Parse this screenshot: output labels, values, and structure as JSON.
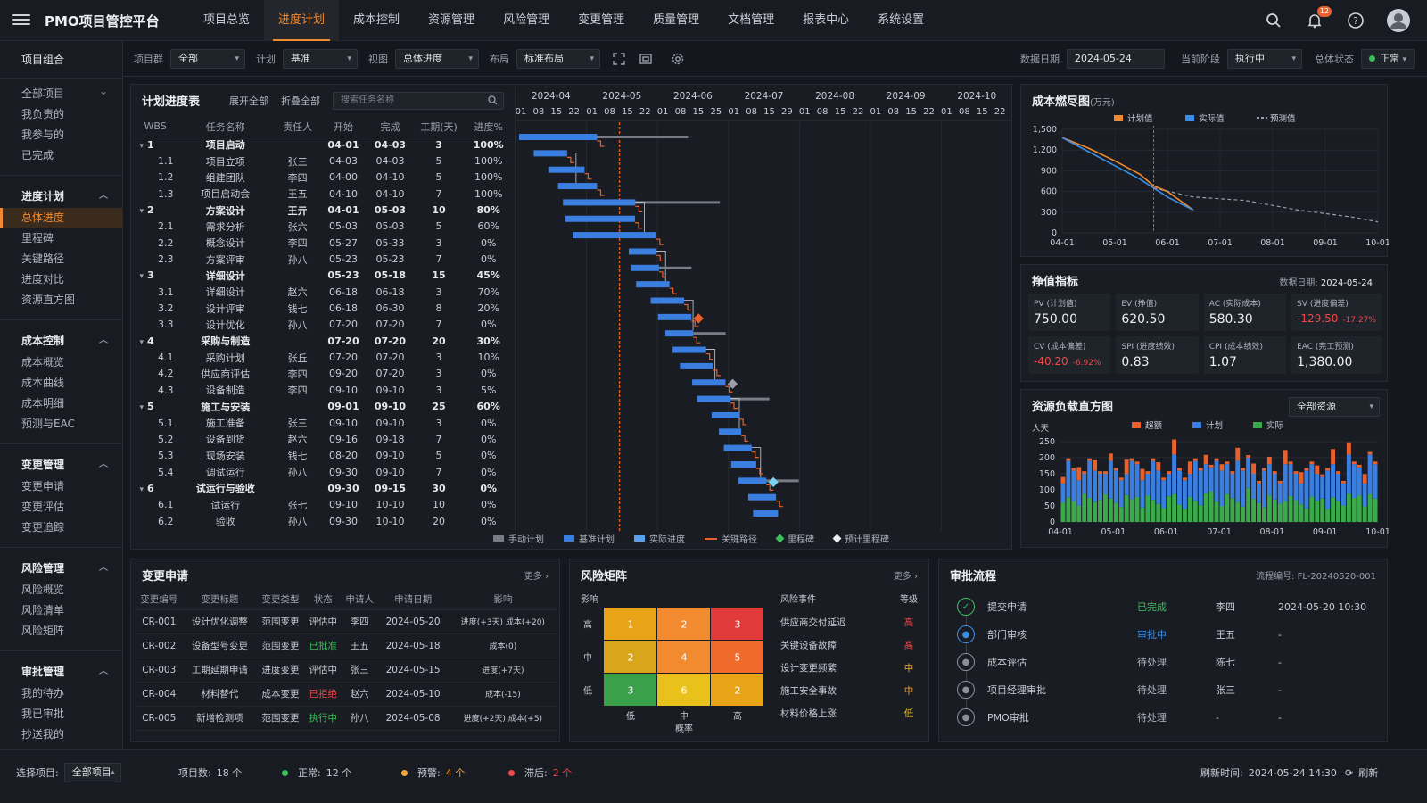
{
  "app": {
    "title": "PMO项目管控平台",
    "notif_count": "12"
  },
  "nav": [
    "项目总览",
    "进度计划",
    "成本控制",
    "资源管理",
    "风险管理",
    "变更管理",
    "质量管理",
    "文档管理",
    "报表中心",
    "系统设置"
  ],
  "sidebar": {
    "head": "项目组合",
    "all": [
      "全部项目",
      "我负责的",
      "我参与的",
      "已完成"
    ],
    "groups": [
      {
        "title": "进度计划",
        "items": [
          "总体进度",
          "里程碑",
          "关键路径",
          "进度对比",
          "资源直方图"
        ]
      },
      {
        "title": "成本控制",
        "items": [
          "成本概览",
          "成本曲线",
          "成本明细",
          "预测与EAC"
        ]
      },
      {
        "title": "变更管理",
        "items": [
          "变更申请",
          "变更评估",
          "变更追踪"
        ]
      },
      {
        "title": "风险管理",
        "items": [
          "风险概览",
          "风险清单",
          "风险矩阵"
        ]
      },
      {
        "title": "审批管理",
        "items": [
          "我的待办",
          "我已审批",
          "抄送我的"
        ]
      }
    ]
  },
  "filters": {
    "group_label": "项目群",
    "group": "全部",
    "plan_label": "计划",
    "plan": "基准",
    "view_label": "视图",
    "view": "总体进度",
    "layout_label": "布局",
    "layout": "标准布局",
    "date_label": "数据日期",
    "date": "2024-05-24",
    "phase_label": "当前阶段",
    "phase": "执行中",
    "status_label": "总体状态",
    "status": "正常"
  },
  "plan": {
    "title": "计划进度表",
    "expand": "展开全部",
    "collapse": "折叠全部",
    "search_placeholder": "搜索任务名称",
    "cols": [
      "WBS",
      "任务名称",
      "责任人",
      "开始",
      "完成",
      "工期(天)",
      "进度%"
    ],
    "rows": [
      {
        "wbs": "1",
        "name": "项目启动",
        "owner": "",
        "start": "04-01",
        "end": "04-03",
        "dur": "3",
        "pct": "100%",
        "grp": true
      },
      {
        "wbs": "1.1",
        "name": "项目立项",
        "owner": "张三",
        "start": "04-03",
        "end": "04-03",
        "dur": "5",
        "pct": "100%"
      },
      {
        "wbs": "1.2",
        "name": "组建团队",
        "owner": "李四",
        "start": "04-00",
        "end": "04-10",
        "dur": "5",
        "pct": "100%"
      },
      {
        "wbs": "1.3",
        "name": "项目启动会",
        "owner": "王五",
        "start": "04-10",
        "end": "04-10",
        "dur": "7",
        "pct": "100%"
      },
      {
        "wbs": "2",
        "name": "方案设计",
        "owner": "王亓",
        "start": "04-01",
        "end": "05-03",
        "dur": "10",
        "pct": "80%",
        "grp": true
      },
      {
        "wbs": "2.1",
        "name": "需求分析",
        "owner": "张六",
        "start": "05-03",
        "end": "05-03",
        "dur": "5",
        "pct": "60%"
      },
      {
        "wbs": "2.2",
        "name": "概念设计",
        "owner": "李四",
        "start": "05-27",
        "end": "05-33",
        "dur": "3",
        "pct": "0%"
      },
      {
        "wbs": "2.3",
        "name": "方案评审",
        "owner": "孙八",
        "start": "05-23",
        "end": "05-23",
        "dur": "7",
        "pct": "0%"
      },
      {
        "wbs": "3",
        "name": "详细设计",
        "owner": "",
        "start": "05-23",
        "end": "05-18",
        "dur": "15",
        "pct": "45%",
        "grp": true
      },
      {
        "wbs": "3.1",
        "name": "详细设计",
        "owner": "赵六",
        "start": "06-18",
        "end": "06-18",
        "dur": "3",
        "pct": "70%"
      },
      {
        "wbs": "3.2",
        "name": "设计评审",
        "owner": "钱七",
        "start": "06-18",
        "end": "06-30",
        "dur": "8",
        "pct": "20%"
      },
      {
        "wbs": "3.3",
        "name": "设计优化",
        "owner": "孙八",
        "start": "07-20",
        "end": "07-20",
        "dur": "7",
        "pct": "0%"
      },
      {
        "wbs": "4",
        "name": "采购与制造",
        "owner": "",
        "start": "07-20",
        "end": "07-20",
        "dur": "20",
        "pct": "30%",
        "grp": true
      },
      {
        "wbs": "4.1",
        "name": "采购计划",
        "owner": "张丘",
        "start": "07-20",
        "end": "07-20",
        "dur": "3",
        "pct": "10%"
      },
      {
        "wbs": "4.2",
        "name": "供应商评估",
        "owner": "李四",
        "start": "09-20",
        "end": "07-20",
        "dur": "3",
        "pct": "0%"
      },
      {
        "wbs": "4.3",
        "name": "设备制造",
        "owner": "李四",
        "start": "09-10",
        "end": "09-10",
        "dur": "3",
        "pct": "5%"
      },
      {
        "wbs": "5",
        "name": "施工与安装",
        "owner": "",
        "start": "09-01",
        "end": "09-10",
        "dur": "25",
        "pct": "60%",
        "grp": true
      },
      {
        "wbs": "5.1",
        "name": "施工准备",
        "owner": "张三",
        "start": "09-10",
        "end": "09-10",
        "dur": "3",
        "pct": "0%"
      },
      {
        "wbs": "5.2",
        "name": "设备到货",
        "owner": "赵六",
        "start": "09-16",
        "end": "09-18",
        "dur": "7",
        "pct": "0%"
      },
      {
        "wbs": "5.3",
        "name": "现场安装",
        "owner": "钱七",
        "start": "08-20",
        "end": "09-10",
        "dur": "5",
        "pct": "0%"
      },
      {
        "wbs": "5.4",
        "name": "调试运行",
        "owner": "孙八",
        "start": "09-30",
        "end": "09-10",
        "dur": "7",
        "pct": "0%"
      },
      {
        "wbs": "6",
        "name": "试运行与验收",
        "owner": "",
        "start": "09-30",
        "end": "09-15",
        "dur": "30",
        "pct": "0%",
        "grp": true
      },
      {
        "wbs": "6.1",
        "name": "试运行",
        "owner": "张七",
        "start": "09-10",
        "end": "10-10",
        "dur": "10",
        "pct": "0%"
      },
      {
        "wbs": "6.2",
        "name": "验收",
        "owner": "孙八",
        "start": "09-30",
        "end": "10-10",
        "dur": "20",
        "pct": "0%"
      }
    ],
    "months": [
      "2024-04",
      "2024-05",
      "2024-06",
      "2024-07",
      "2024-08",
      "2024-09",
      "2024-10"
    ],
    "days": [
      [
        "01",
        "08",
        "15",
        "22"
      ],
      [
        "01",
        "08",
        "15",
        "22"
      ],
      [
        "01",
        "08",
        "15",
        "25"
      ],
      [
        "01",
        "08",
        "15",
        "29"
      ],
      [
        "01",
        "08",
        "15",
        "22"
      ],
      [
        "01",
        "08",
        "15",
        "22"
      ],
      [
        "01",
        "08",
        "15",
        "22"
      ]
    ],
    "legend": [
      "手动计划",
      "基准计划",
      "实际进度",
      "关键路径",
      "里程碑",
      "预计里程碑"
    ]
  },
  "burn": {
    "title": "成本燃尽图",
    "unit": "(万元)",
    "legend": [
      "计划值",
      "实际值",
      "预测值"
    ],
    "yticks": [
      "1,500",
      "1,200",
      "900",
      "600",
      "300",
      "0"
    ],
    "xticks": [
      "04-01",
      "05-01",
      "06-01",
      "07-01",
      "08-01",
      "09-01",
      "10-01"
    ]
  },
  "ev": {
    "title": "挣值指标",
    "date_label": "数据日期:",
    "date": "2024-05-24",
    "cells": [
      {
        "label": "PV (计划值)",
        "value": "750.00"
      },
      {
        "label": "EV (挣值)",
        "value": "620.50"
      },
      {
        "label": "AC (实际成本)",
        "value": "580.30"
      },
      {
        "label": "SV (进度偏差)",
        "value": "-129.50",
        "pct": "-17.27%",
        "neg": true
      },
      {
        "label": "CV (成本偏差)",
        "value": "-40.20",
        "pct": "-6.92%",
        "neg": true
      },
      {
        "label": "SPI (进度绩效)",
        "value": "0.83"
      },
      {
        "label": "CPI (成本绩效)",
        "value": "1.07"
      },
      {
        "label": "EAC (完工预测)",
        "value": "1,380.00"
      }
    ]
  },
  "res": {
    "title": "资源负载直方图",
    "select": "全部资源",
    "unit": "人天",
    "legend": [
      "超额",
      "计划",
      "实际"
    ],
    "yticks": [
      "250",
      "200",
      "150",
      "100",
      "50",
      "0"
    ],
    "xticks": [
      "04-01",
      "05-01",
      "06-01",
      "07-01",
      "08-01",
      "09-01",
      "10-01"
    ]
  },
  "chg": {
    "title": "变更申请",
    "more": "更多 ›",
    "cols": [
      "变更编号",
      "变更标题",
      "变更类型",
      "状态",
      "申请人",
      "申请日期",
      "影响"
    ],
    "rows": [
      {
        "id": "CR-001",
        "title": "设计优化调整",
        "type": "范围变更",
        "status": "评估中",
        "sc": "#c8ccd4",
        "who": "李四",
        "date": "2024-05-20",
        "impact": "进度(+3天) 成本(+20)"
      },
      {
        "id": "CR-002",
        "title": "设备型号变更",
        "type": "范围变更",
        "status": "已批准",
        "sc": "#3bbf5a",
        "who": "王五",
        "date": "2024-05-18",
        "impact": "成本(0)"
      },
      {
        "id": "CR-003",
        "title": "工期延期申请",
        "type": "进度变更",
        "status": "评估中",
        "sc": "#c8ccd4",
        "who": "张三",
        "date": "2024-05-15",
        "impact": "进度(+7天)"
      },
      {
        "id": "CR-004",
        "title": "材料替代",
        "type": "成本变更",
        "status": "已拒绝",
        "sc": "#f04848",
        "who": "赵六",
        "date": "2024-05-10",
        "impact": "成本(-15)"
      },
      {
        "id": "CR-005",
        "title": "新增检测项",
        "type": "范围变更",
        "status": "执行中",
        "sc": "#3bbf5a",
        "who": "孙八",
        "date": "2024-05-08",
        "impact": "进度(+2天) 成本(+5)"
      }
    ]
  },
  "risk": {
    "title": "风险矩阵",
    "more": "更多 ›",
    "ylabel": "影响",
    "xlabel": "概率",
    "rows": [
      "高",
      "中",
      "低"
    ],
    "cols": [
      "低",
      "中",
      "高"
    ],
    "cells": [
      [
        "1",
        "2",
        "3"
      ],
      [
        "2",
        "4",
        "5"
      ],
      [
        "3",
        "6",
        "2"
      ]
    ],
    "colors": [
      [
        "#e8a317",
        "#f28b30",
        "#e03a3a"
      ],
      [
        "#d9a51a",
        "#f28b30",
        "#f06a2c"
      ],
      [
        "#3aa04a",
        "#e8c21a",
        "#e8a317"
      ]
    ],
    "ev_label": "风险事件",
    "lvl_label": "等级",
    "events": [
      {
        "name": "供应商交付延迟",
        "lvl": "高",
        "c": "#f04848"
      },
      {
        "name": "关键设备故障",
        "lvl": "高",
        "c": "#f04848"
      },
      {
        "name": "设计变更频繁",
        "lvl": "中",
        "c": "#f2a23a"
      },
      {
        "name": "施工安全事故",
        "lvl": "中",
        "c": "#f2a23a"
      },
      {
        "name": "材料价格上涨",
        "lvl": "低",
        "c": "#e8c21a"
      }
    ]
  },
  "appr": {
    "title": "审批流程",
    "flow_no": "流程编号: FL-20240520-001",
    "steps": [
      {
        "name": "提交申请",
        "status": "已完成",
        "sc": "#3bbf5a",
        "who": "李四",
        "time": "2024-05-20 10:30",
        "ic": "#3bbf5a"
      },
      {
        "name": "部门审核",
        "status": "审批中",
        "sc": "#3a8ee6",
        "who": "王五",
        "time": "-",
        "ic": "#3a8ee6"
      },
      {
        "name": "成本评估",
        "status": "待处理",
        "sc": "#b0b5be",
        "who": "陈七",
        "time": "-",
        "ic": "#8a8f99"
      },
      {
        "name": "项目经理审批",
        "status": "待处理",
        "sc": "#b0b5be",
        "who": "张三",
        "time": "-",
        "ic": "#8a8f99"
      },
      {
        "name": "PMO审批",
        "status": "待处理",
        "sc": "#b0b5be",
        "who": "-",
        "time": "-",
        "ic": "#8a8f99"
      }
    ]
  },
  "footer": {
    "sel_label": "选择项目:",
    "sel": "全部项目",
    "count_label": "项目数:",
    "count": "18 个",
    "normal_label": "正常:",
    "normal": "12 个",
    "warn_label": "预警:",
    "warn": "4 个",
    "late_label": "滞后:",
    "late": "2 个",
    "refresh_label": "刷新时间:",
    "refresh_time": "2024-05-24 14:30",
    "refresh": "刷新"
  }
}
